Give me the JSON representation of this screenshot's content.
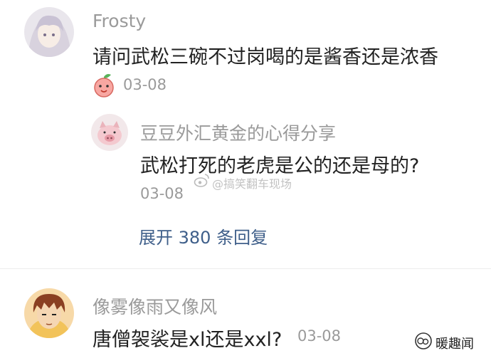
{
  "comments": [
    {
      "user": "Frosty",
      "text": "请问武松三碗不过岗喝的是酱香还是浓香",
      "date": "03-08",
      "reply": {
        "user": "豆豆外汇黄金的心得分享",
        "text": "武松打死的老虎是公的还是母的?",
        "date": "03-08"
      },
      "expand_label": "展开 380 条回复"
    },
    {
      "user": "像雾像雨又像风",
      "text": "唐僧袈裟是xl还是xxl?",
      "date": "03-08"
    }
  ],
  "watermark": "@搞笑翻车现场",
  "brand": "暖趣闻",
  "colors": {
    "username": "#9a9a9a",
    "comment_text": "#222222",
    "expand_link": "#3f5f8a"
  }
}
